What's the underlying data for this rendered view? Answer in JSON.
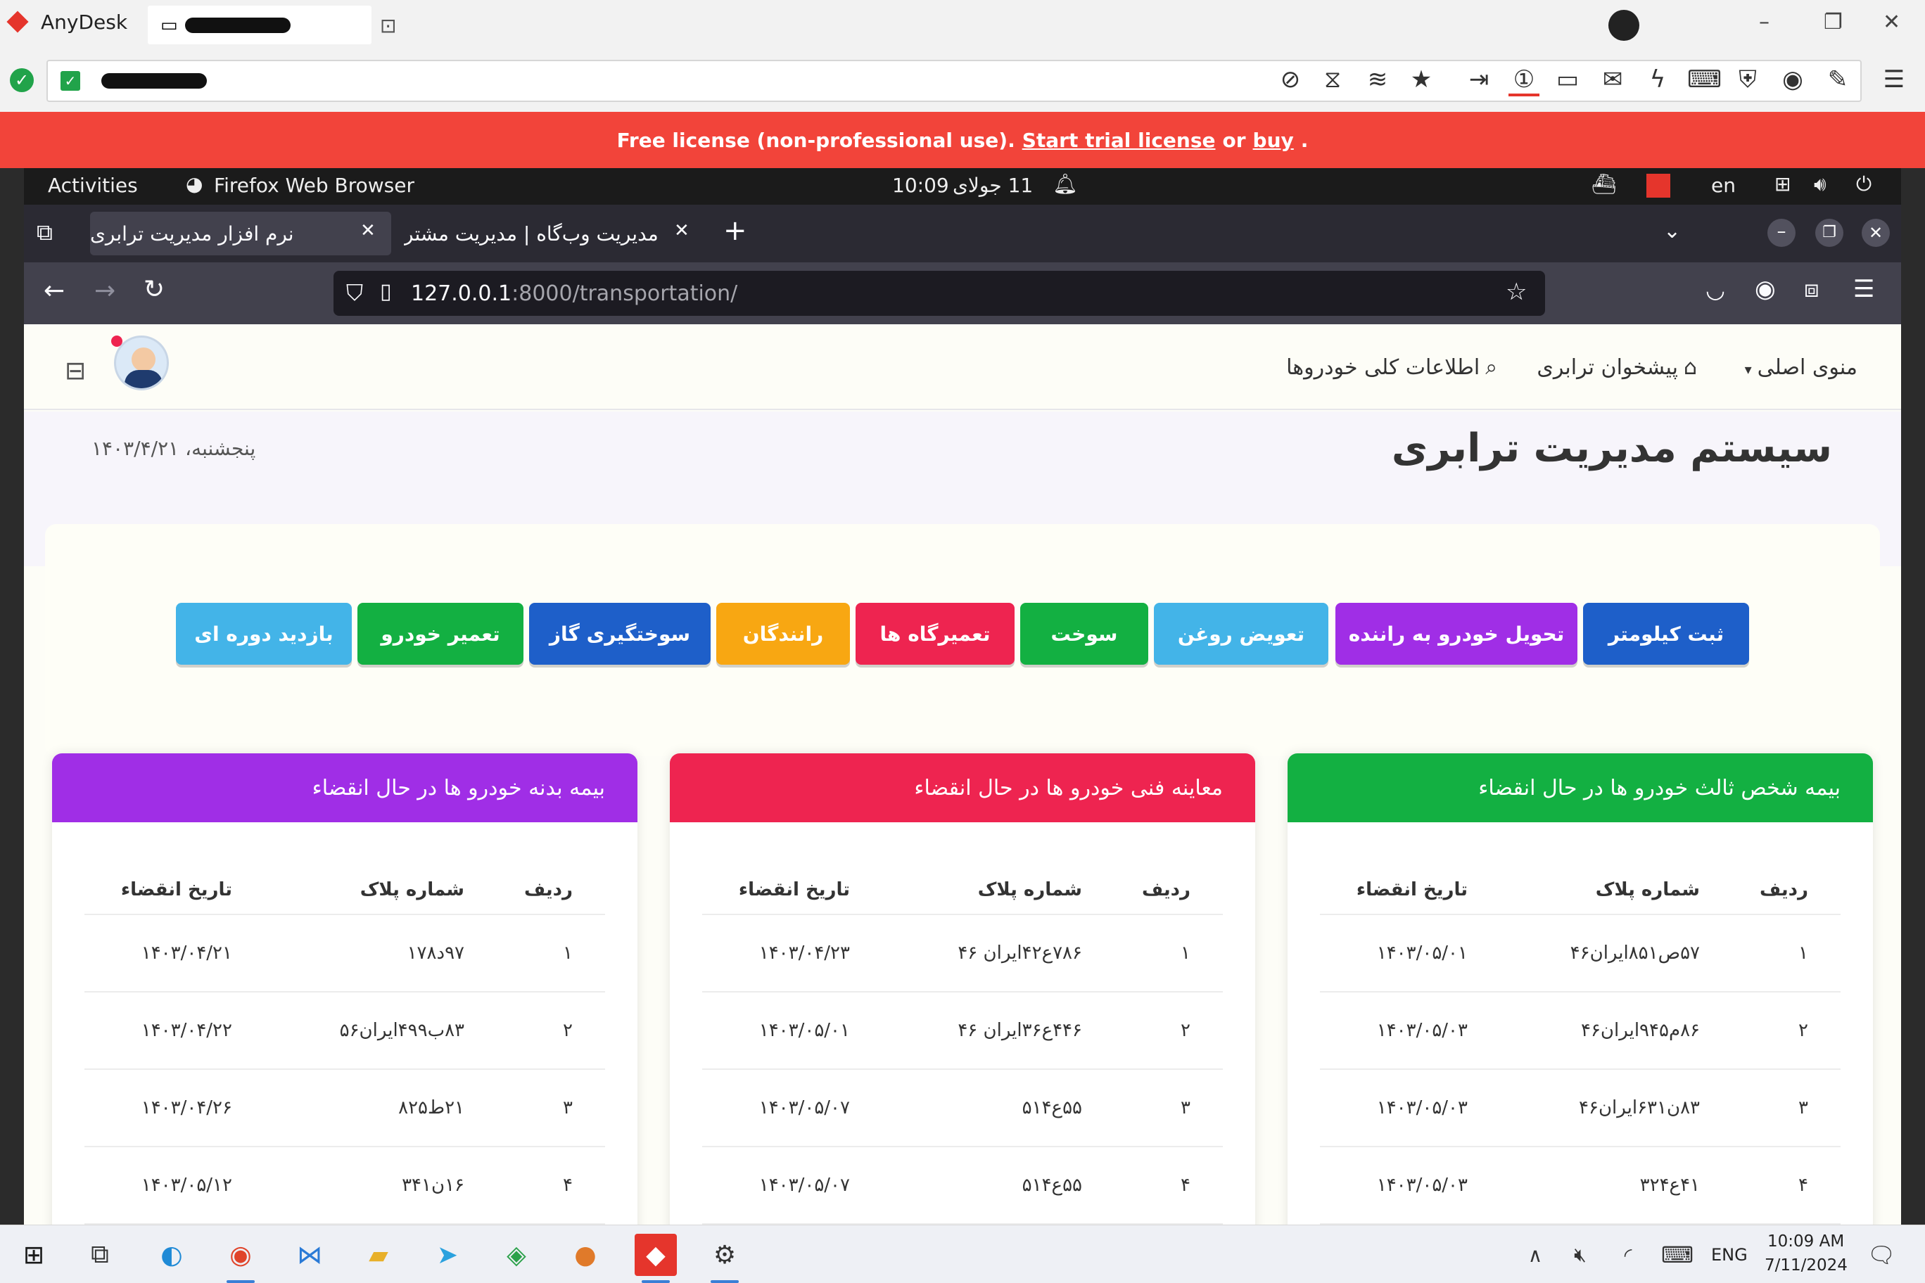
{
  "anydesk": {
    "app_name": "AnyDesk",
    "license_text": "Free license (non-professional use).",
    "trial_link": "Start trial license",
    "or_text": "or",
    "buy_link": "buy"
  },
  "gnome": {
    "activities": "Activities",
    "app": "Firefox Web Browser",
    "time": "10:09",
    "date": "11 جولای",
    "lang": "en"
  },
  "firefox": {
    "tabs": [
      {
        "label": "نرم افزار مدیریت ترابری",
        "active": true
      },
      {
        "label": "مدیریت وب‌گاه | مدیریت مشتر",
        "active": false
      }
    ],
    "url_host": "127.0.0.1",
    "url_path": ":8000/transportation/"
  },
  "nav": {
    "main_menu": "منوی اصلی",
    "dashboard": "پیشخوان ترابری",
    "vehicles_info": "اطلاعات کلی خودروها"
  },
  "header": {
    "title": "سیستم مدیریت ترابری",
    "date": "پنجشنبه، ۱۴۰۳/۴/۲۱"
  },
  "buttons": [
    {
      "label": "ثبت کیلومتر",
      "color": "#1e5fc9"
    },
    {
      "label": "تحویل خودرو به راننده",
      "color": "#a02ee6"
    },
    {
      "label": "تعویض روغن",
      "color": "#43b4e8"
    },
    {
      "label": "سوخت",
      "color": "#13b042"
    },
    {
      "label": "تعمیرگاه ها",
      "color": "#ee2450"
    },
    {
      "label": "رانندگان",
      "color": "#f8a712"
    },
    {
      "label": "سوختگیری گاز",
      "color": "#1e5fc9"
    },
    {
      "label": "تعمیر خودرو",
      "color": "#13b042"
    },
    {
      "label": "بازدید دوره ای",
      "color": "#43b4e8"
    }
  ],
  "cards": [
    {
      "title": "بیمه شخص ثالث خودرو ها در حال انقضاء",
      "color": "#13b042",
      "headers": [
        "ردیف",
        "شماره پلاک",
        "تاریخ انقضاء"
      ],
      "rows": [
        [
          "۱",
          "۵۷ص۸۵۱ایران۴۶",
          "۱۴۰۳/۰۵/۰۱"
        ],
        [
          "۲",
          "۸۶م۹۴۵ایران۴۶",
          "۱۴۰۳/۰۵/۰۳"
        ],
        [
          "۳",
          "۸۳ن۶۳۱ایران۴۶",
          "۱۴۰۳/۰۵/۰۳"
        ],
        [
          "۴",
          "۴۱ع۳۲۴",
          "۱۴۰۳/۰۵/۰۳"
        ]
      ]
    },
    {
      "title": "معاینه فنی خودرو ها در حال انقضاء",
      "color": "#ee2450",
      "headers": [
        "ردیف",
        "شماره پلاک",
        "تاریخ انقضاء"
      ],
      "rows": [
        [
          "۱",
          "۷۸۶ع۴۲ایران ۴۶",
          "۱۴۰۳/۰۴/۲۳"
        ],
        [
          "۲",
          "۴۴۶ع۳۶ایران ۴۶",
          "۱۴۰۳/۰۵/۰۱"
        ],
        [
          "۳",
          "۵۵ع۵۱۴",
          "۱۴۰۳/۰۵/۰۷"
        ],
        [
          "۴",
          "۵۵ع۵۱۴",
          "۱۴۰۳/۰۵/۰۷"
        ]
      ]
    },
    {
      "title": "بیمه بدنه خودرو ها در حال انقضاء",
      "color": "#a02ee6",
      "headers": [
        "ردیف",
        "شماره پلاک",
        "تاریخ انقضاء"
      ],
      "rows": [
        [
          "۱",
          "۹۷د۱۷۸",
          "۱۴۰۳/۰۴/۲۱"
        ],
        [
          "۲",
          "۸۳ب۴۹۹ایران۵۶",
          "۱۴۰۳/۰۴/۲۲"
        ],
        [
          "۳",
          "۲۱ط۸۲۵",
          "۱۴۰۳/۰۴/۲۶"
        ],
        [
          "۴",
          "۱۶ن۳۴۱",
          "۱۴۰۳/۰۵/۱۲"
        ]
      ]
    }
  ],
  "taskbar": {
    "lang": "ENG",
    "time": "10:09 AM",
    "date": "7/11/2024"
  }
}
